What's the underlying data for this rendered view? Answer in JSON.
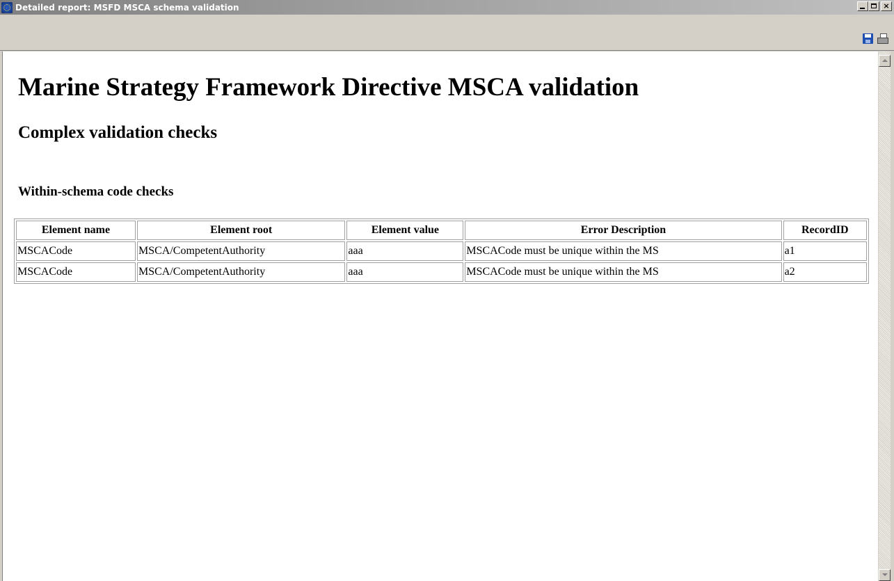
{
  "window": {
    "title": "Detailed report: MSFD MSCA schema validation",
    "minimize_label": "_",
    "close_label": "×"
  },
  "toolbar": {
    "icons": [
      "save-icon",
      "print-icon"
    ]
  },
  "page": {
    "title": "Marine Strategy Framework Directive MSCA validation",
    "section_title": "Complex validation checks",
    "subsection_title": "Within-schema code checks"
  },
  "table": {
    "headers": [
      "Element name",
      "Element root",
      "Element value",
      "Error Description",
      "RecordID"
    ],
    "rows": [
      [
        "MSCACode",
        "MSCA/CompetentAuthority",
        "aaa",
        "MSCACode must be unique within the MS",
        "a1"
      ],
      [
        "MSCACode",
        "MSCA/CompetentAuthority",
        "aaa",
        "MSCACode must be unique within the MS",
        "a2"
      ]
    ]
  },
  "colors": {
    "titlebar": "#808080",
    "chrome": "#d4d0c8",
    "table_border": "#a0a0a0"
  }
}
